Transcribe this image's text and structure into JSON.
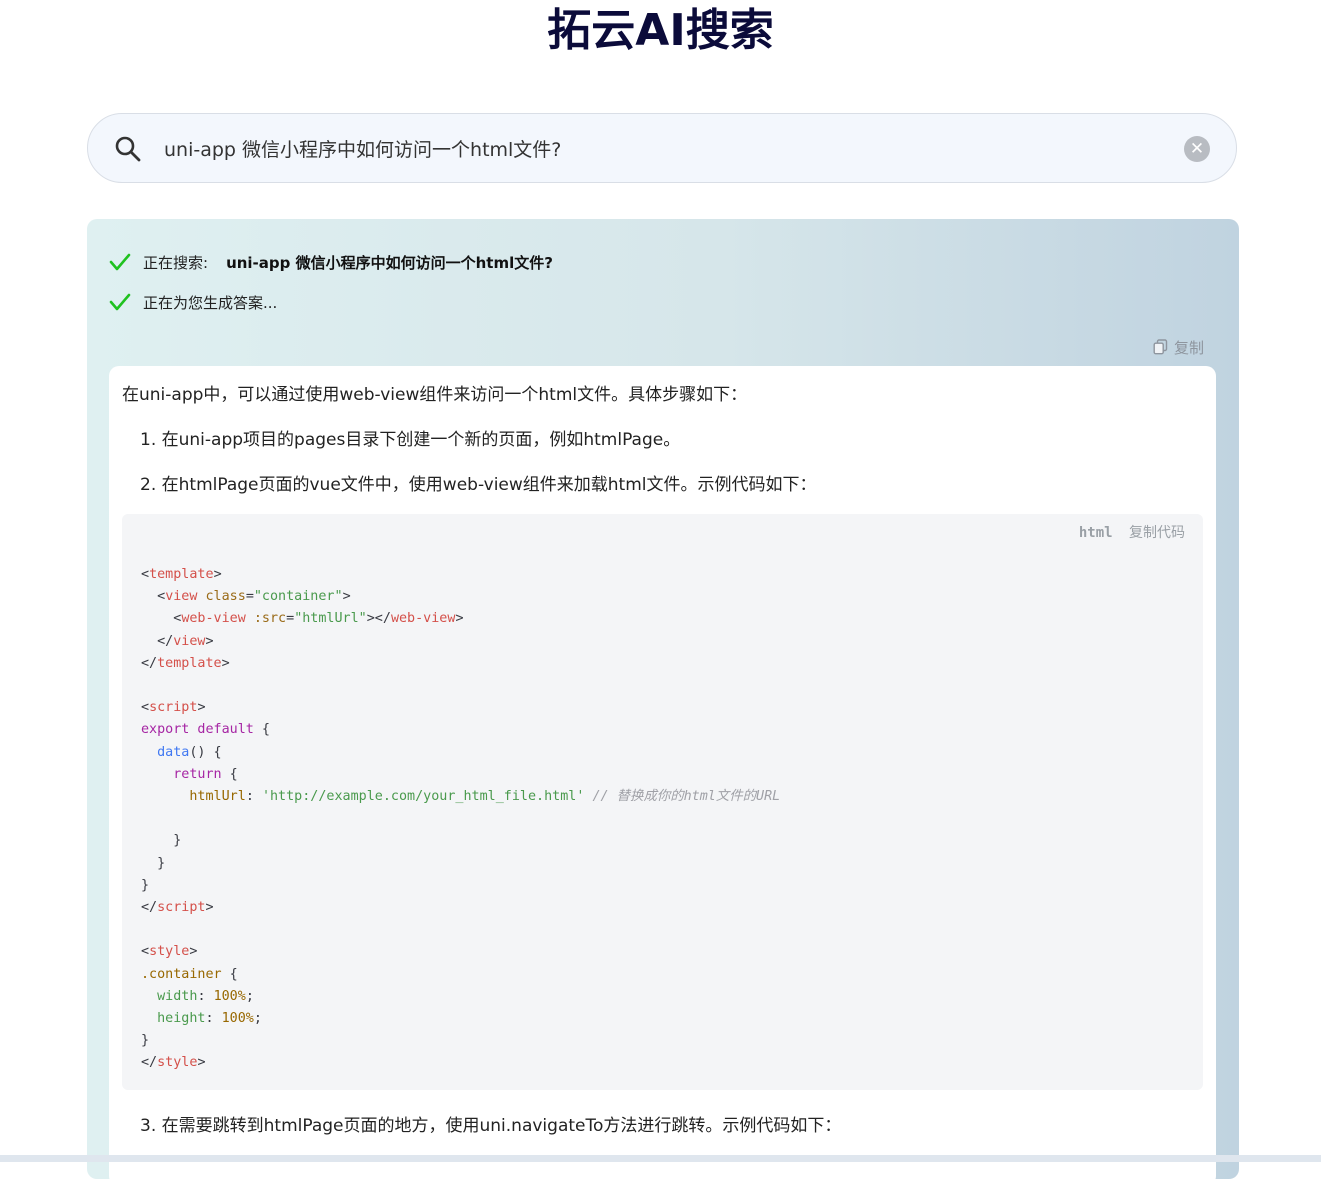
{
  "app": {
    "title": "拓云AI搜索"
  },
  "search": {
    "value": "uni-app 微信小程序中如何访问一个html文件?",
    "placeholder": ""
  },
  "status": {
    "searching_label": "正在搜索:",
    "searching_query": "uni-app 微信小程序中如何访问一个html文件?",
    "generating_label": "正在为您生成答案..."
  },
  "toolbar": {
    "copy_label": "复制"
  },
  "answer": {
    "intro": "在uni-app中，可以通过使用web-view组件来访问一个html文件。具体步骤如下：",
    "steps": [
      "1. 在uni-app项目的pages目录下创建一个新的页面，例如htmlPage。",
      "2. 在htmlPage页面的vue文件中，使用web-view组件来加载html文件。示例代码如下：",
      "3. 在需要跳转到htmlPage页面的地方，使用uni.navigateTo方法进行跳转。示例代码如下："
    ],
    "code_block": {
      "language": "html",
      "copy_label": "复制代码",
      "lines": {
        "l1_tag": "template",
        "l2_tag": "view",
        "l2_attr": "class",
        "l2_val": "\"container\"",
        "l3_tag": "web-view",
        "l3_attr": ":src",
        "l3_val": "\"htmlUrl\"",
        "script_tag": "script",
        "export_default": "export default",
        "data_fn": "data",
        "return_kw": "return",
        "html_url_key": "htmlUrl",
        "html_url_value": "'http://example.com/your_html_file.html'",
        "comment": "// 替换成你的html文件的URL",
        "style_tag": "style",
        "selector": ".container",
        "width_prop": "width",
        "width_val": "100%",
        "height_prop": "height",
        "height_val": "100%"
      }
    }
  },
  "colors": {
    "title": "#0b0b3a",
    "check": "#1fc21f",
    "panel_start": "#dff0f1",
    "panel_end": "#c0d3e0"
  },
  "icons": [
    "search-icon",
    "clear-icon",
    "check-icon",
    "copy-icon"
  ]
}
